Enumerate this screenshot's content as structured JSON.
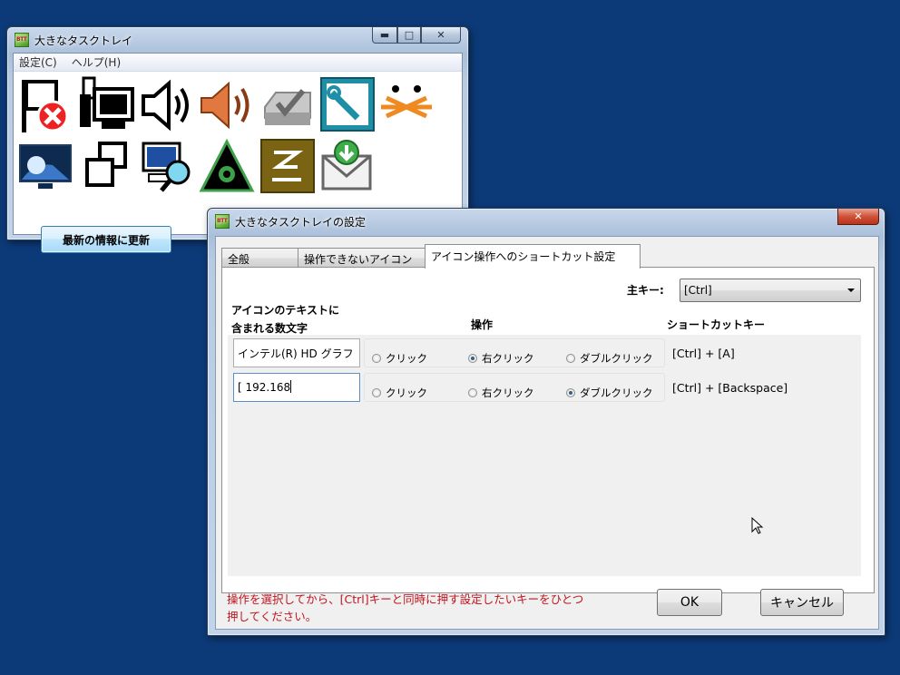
{
  "tray_window": {
    "title": "大きなタスクトレイ",
    "menu": [
      "設定(C)",
      "ヘルプ(H)"
    ],
    "caption_buttons": {
      "minimize": "▬",
      "maximize": "□",
      "close": "✕"
    },
    "icons": [
      "flag-error-icon",
      "network-icon",
      "speaker-outline-icon",
      "speaker-volume-icon",
      "printer-check-icon",
      "wrench-tool-icon",
      "bluetooth-icon",
      "display-icon",
      "windows-switch-icon",
      "computer-search-icon",
      "eye-triangle-icon",
      "logo-box-icon",
      "mail-download-icon"
    ],
    "refresh_button": "最新の情報に更新"
  },
  "settings_dialog": {
    "title": "大きなタスクトレイの設定",
    "caption_close": "✕",
    "tabs": [
      "全般",
      "操作できないアイコン",
      "アイコン操作へのショートカット設定"
    ],
    "active_tab": 2,
    "main_key_label": "主キー:",
    "main_key_value": "[Ctrl]",
    "headers": {
      "icon_text_line1": "アイコンのテキストに",
      "icon_text_line2": "含まれる数文字",
      "operation": "操作",
      "shortcut_key": "ショートカットキー"
    },
    "rows": [
      {
        "text": "インテル(R) HD グラフ",
        "options": [
          "クリック",
          "右クリック",
          "ダブルクリック"
        ],
        "selected": 1,
        "shortcut": "[Ctrl] + [A]"
      },
      {
        "text": "[ 192.168",
        "options": [
          "クリック",
          "右クリック",
          "ダブルクリック"
        ],
        "selected": 2,
        "shortcut": "[Ctrl] + [Backspace]"
      }
    ],
    "hint_line1": "操作を選択してから、[Ctrl]キーと同時に押す設定したいキーをひとつ",
    "hint_line2": "押してください。",
    "ok_label": "OK",
    "cancel_label": "キャンセル"
  },
  "colors": {
    "desktop": "#0c3a78",
    "hint_text": "#c0141e"
  }
}
